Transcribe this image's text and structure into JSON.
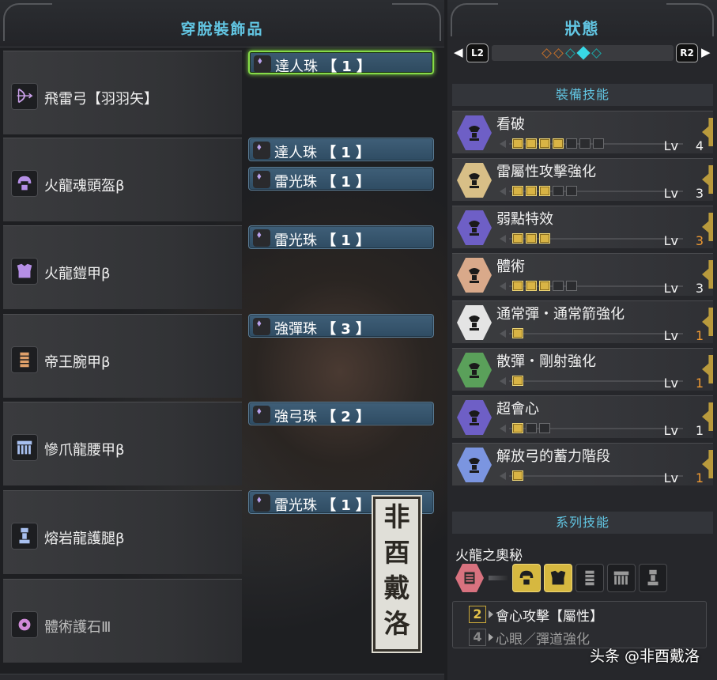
{
  "left_panel": {
    "title": "穿脫裝飾品",
    "equipment": [
      {
        "name": "飛雷弓【羽羽矢】",
        "icon": "bow-icon",
        "icon_color": "#c9a0e8",
        "decorations": [
          {
            "name": "達人珠",
            "level": "【 1 】",
            "icon": "decoration-gem-icon",
            "selected": true
          }
        ]
      },
      {
        "name": "火龍魂頭盔β",
        "icon": "helmet-icon",
        "icon_color": "#b58fe6",
        "decorations": [
          {
            "name": "達人珠",
            "level": "【 1 】",
            "icon": "decoration-gem-icon"
          },
          {
            "name": "雷光珠",
            "level": "【 1 】",
            "icon": "decoration-gem-icon"
          }
        ]
      },
      {
        "name": "火龍鎧甲β",
        "icon": "chest-armor-icon",
        "icon_color": "#b58fe6",
        "decorations": [
          {
            "name": "雷光珠",
            "level": "【 1 】",
            "icon": "decoration-gem-icon"
          }
        ]
      },
      {
        "name": "帝王腕甲β",
        "icon": "gauntlet-icon",
        "icon_color": "#e0a06a",
        "decorations": [
          {
            "name": "強彈珠",
            "level": "【 3 】",
            "icon": "decoration-gem-icon"
          }
        ]
      },
      {
        "name": "慘爪龍腰甲β",
        "icon": "waist-armor-icon",
        "icon_color": "#a8c0f0",
        "decorations": [
          {
            "name": "強弓珠",
            "level": "【 2 】",
            "icon": "decoration-gem-icon"
          }
        ]
      },
      {
        "name": "熔岩龍護腿β",
        "icon": "leg-armor-icon",
        "icon_color": "#a8c0f0",
        "decorations": [
          {
            "name": "雷光珠",
            "level": "【 1 】",
            "icon": "decoration-gem-icon"
          }
        ]
      },
      {
        "name": "體術護石Ⅲ",
        "icon": "charm-icon",
        "icon_color": "#d08ad8",
        "dim": true,
        "decorations": []
      }
    ],
    "seal_chars": [
      "非",
      "酉",
      "戴",
      "洛"
    ]
  },
  "right_panel": {
    "title": "狀態",
    "pager": {
      "left_button": "L2",
      "right_button": "R2",
      "left_arrow": "◀",
      "right_arrow": "▶",
      "dot_colors": [
        "#c26f2a",
        "#c26f2a",
        "#1aa7a7",
        "#38d8e6",
        "#1aa7a7"
      ],
      "active_index": 3
    },
    "equip_skills_header": "裝備技能",
    "skills": [
      {
        "name": "看破",
        "level_label": "Lv",
        "level": "4",
        "filled": 4,
        "max": 7,
        "maxed": false,
        "color": "#6e5fc6"
      },
      {
        "name": "雷屬性攻擊強化",
        "level_label": "Lv",
        "level": "3",
        "filled": 3,
        "max": 5,
        "maxed": false,
        "color": "#d8bf87"
      },
      {
        "name": "弱點特效",
        "level_label": "Lv",
        "level": "3",
        "filled": 3,
        "max": 3,
        "maxed": true,
        "color": "#6e5fc6"
      },
      {
        "name": "體術",
        "level_label": "Lv",
        "level": "3",
        "filled": 3,
        "max": 5,
        "maxed": false,
        "color": "#d9a98a"
      },
      {
        "name": "通常彈・通常箭強化",
        "level_label": "Lv",
        "level": "1",
        "filled": 1,
        "max": 1,
        "maxed": true,
        "color": "#e4e4e4"
      },
      {
        "name": "散彈・剛射強化",
        "level_label": "Lv",
        "level": "1",
        "filled": 1,
        "max": 1,
        "maxed": true,
        "color": "#5aa05a"
      },
      {
        "name": "超會心",
        "level_label": "Lv",
        "level": "1",
        "filled": 1,
        "max": 3,
        "maxed": false,
        "color": "#6e5fc6"
      },
      {
        "name": "解放弓的蓄力階段",
        "level_label": "Lv",
        "level": "1",
        "filled": 1,
        "max": 1,
        "maxed": true,
        "color": "#7b95e0"
      }
    ],
    "set_skills_header": "系列技能",
    "set": {
      "name": "火龍之奧秘",
      "pieces": [
        {
          "icon": "set-skill-icon",
          "state": "first"
        },
        {
          "icon": "helmet-icon",
          "state": "on"
        },
        {
          "icon": "chest-armor-icon",
          "state": "on"
        },
        {
          "icon": "gauntlet-icon",
          "state": "off"
        },
        {
          "icon": "waist-armor-icon",
          "state": "off"
        },
        {
          "icon": "leg-armor-icon",
          "state": "off"
        }
      ],
      "bonuses": [
        {
          "pieces": "2",
          "text": "會心攻擊【屬性】",
          "active": true
        },
        {
          "pieces": "4",
          "text": "心眼／彈道強化",
          "active": false
        }
      ]
    }
  },
  "watermark": "头条 @非酉戴洛"
}
